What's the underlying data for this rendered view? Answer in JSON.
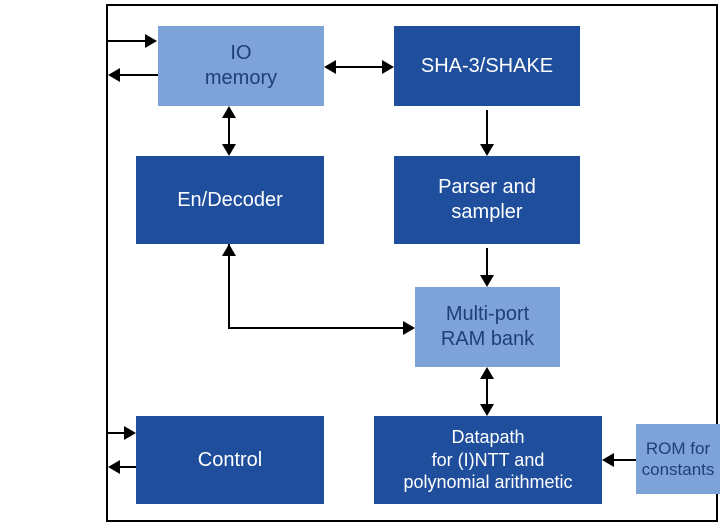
{
  "blocks": {
    "io_memory": "IO\nmemory",
    "sha3": "SHA-3/SHAKE",
    "encoder": "En/Decoder",
    "parser": "Parser and\nsampler",
    "rambank": "Multi-port\nRAM bank",
    "control": "Control",
    "datapath": "Datapath\nfor (I)NTT and\npolynomial arithmetic",
    "rom": "ROM for\nconstants"
  }
}
